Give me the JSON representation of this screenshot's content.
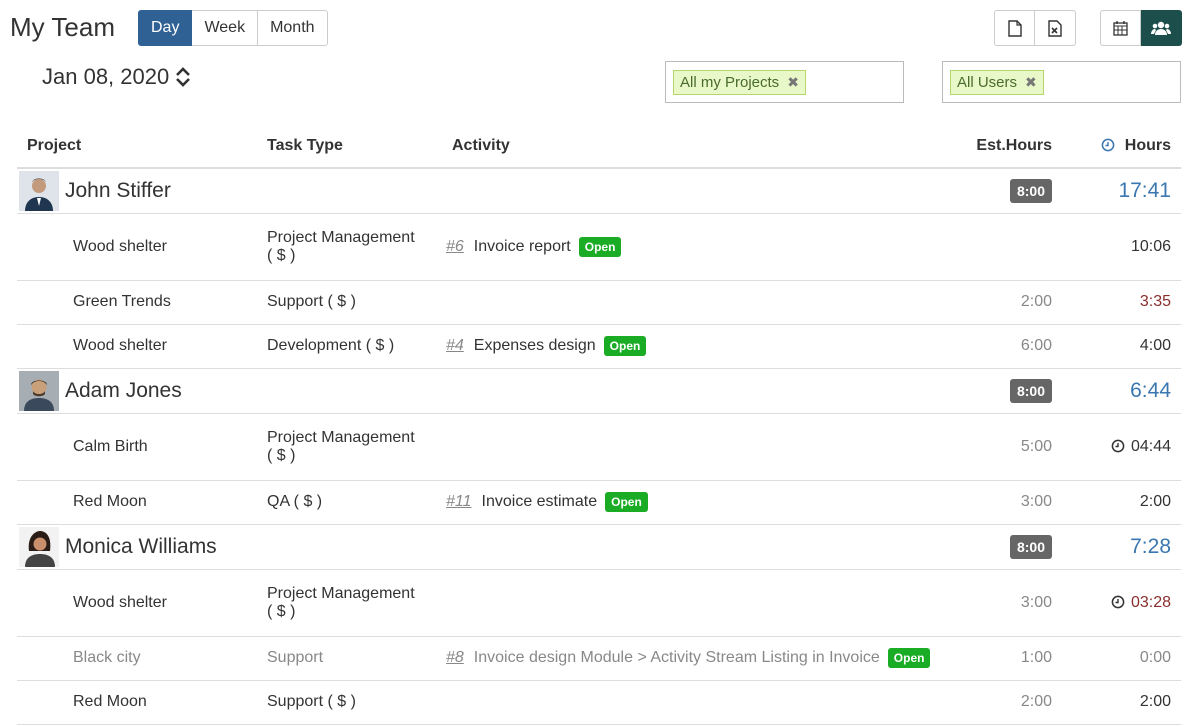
{
  "header": {
    "title": "My Team",
    "ranges": [
      "Day",
      "Week",
      "Month"
    ],
    "active_range": "Day",
    "date": "Jan 08, 2020"
  },
  "filters": {
    "projects": "All my Projects",
    "users": "All Users"
  },
  "toolbar": {
    "icons": [
      "file-icon",
      "excel-icon",
      "calendar-icon",
      "users-icon"
    ]
  },
  "columns": {
    "project": "Project",
    "task_type": "Task Type",
    "activity": "Activity",
    "est_hours": "Est.Hours",
    "hours": "Hours"
  },
  "colors": {
    "primary": "#2f6195",
    "accent_dark": "#1c4e4b",
    "open": "#19ac24",
    "total": "#3a77b0"
  },
  "groups": [
    {
      "name": "John Stiffer",
      "est": "8:00",
      "total": "17:41",
      "rows": [
        {
          "project": "Wood shelter",
          "task_line1": "Project Management",
          "task_line2": "( $ )",
          "act_id": "#6",
          "act_name": "Invoice report",
          "status": "Open",
          "est": "",
          "hours": "10:06"
        },
        {
          "project": "Green Trends",
          "task_line1": "Support ( $ )",
          "task_line2": "",
          "act_id": "",
          "act_name": "",
          "status": "",
          "est": "2:00",
          "hours": "3:35"
        },
        {
          "project": "Wood shelter",
          "task_line1": "Development ( $ )",
          "task_line2": "",
          "act_id": "#4",
          "act_name": "Expenses design",
          "status": "Open",
          "est": "6:00",
          "hours": "4:00"
        }
      ]
    },
    {
      "name": "Adam Jones",
      "est": "8:00",
      "total": "6:44",
      "rows": [
        {
          "project": "Calm Birth",
          "task_line1": "Project Management",
          "task_line2": "( $ )",
          "act_id": "",
          "act_name": "",
          "status": "",
          "est": "5:00",
          "hours": "04:44"
        },
        {
          "project": "Red Moon",
          "task_line1": "QA ( $ )",
          "task_line2": "",
          "act_id": "#11",
          "act_name": "Invoice estimate",
          "status": "Open",
          "est": "3:00",
          "hours": "2:00"
        }
      ]
    },
    {
      "name": "Monica Williams",
      "est": "8:00",
      "total": "7:28",
      "rows": [
        {
          "project": "Wood shelter",
          "task_line1": "Project Management",
          "task_line2": "( $ )",
          "act_id": "",
          "act_name": "",
          "status": "",
          "est": "3:00",
          "hours": "03:28"
        },
        {
          "project": "Black city",
          "task_line1": "Support",
          "task_line2": "",
          "act_id": "#8",
          "act_name": "Invoice design Module > Activity Stream Listing in Invoice",
          "status": "Open",
          "est": "1:00",
          "hours": "0:00"
        },
        {
          "project": "Red Moon",
          "task_line1": "Support ( $ )",
          "task_line2": "",
          "act_id": "",
          "act_name": "",
          "status": "",
          "est": "2:00",
          "hours": "2:00"
        }
      ]
    }
  ]
}
